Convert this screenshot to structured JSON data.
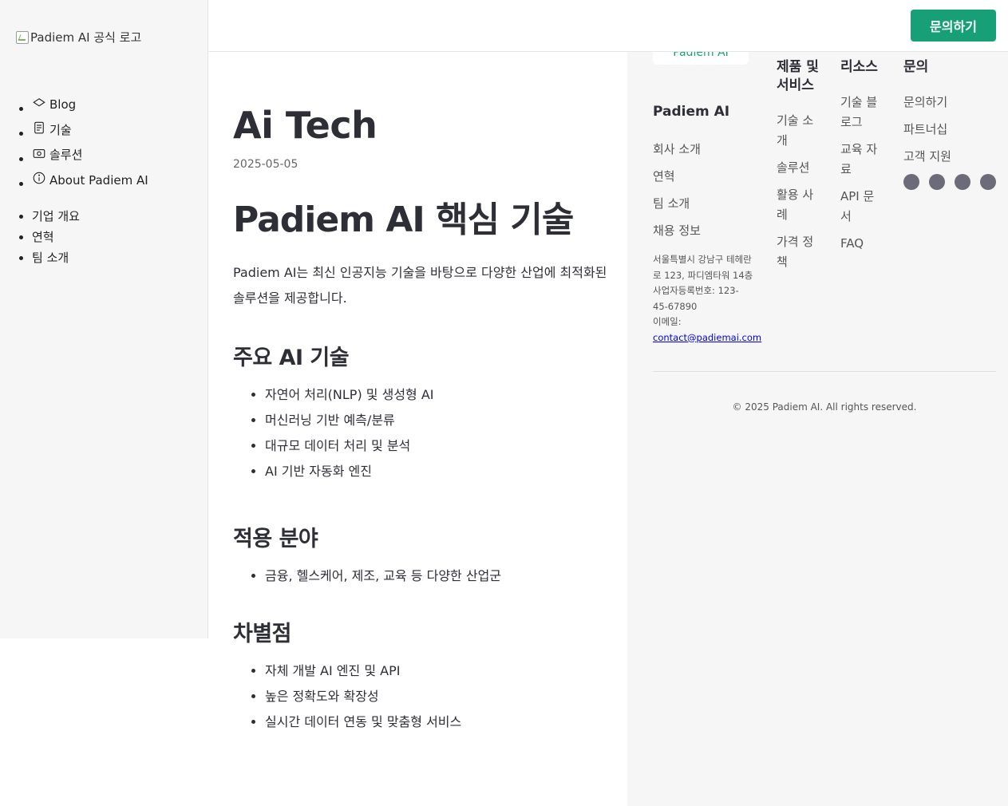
{
  "sidebar": {
    "logo_alt": "Padiem AI 공식 로고",
    "nav": [
      {
        "label": "Blog",
        "icon": "layers-icon"
      },
      {
        "label": "기술",
        "icon": "document-icon"
      },
      {
        "label": "솔루션",
        "icon": "camera-icon"
      },
      {
        "label": "About Padiem AI",
        "icon": "info-icon"
      }
    ],
    "sub": [
      "기업 개요",
      "연혁",
      "팀 소개"
    ]
  },
  "header": {
    "cta_label": "문의하기",
    "accent": "#17a077"
  },
  "article": {
    "title": "Ai Tech",
    "date": "2025-05-05",
    "heading": "Padiem AI 핵심 기술",
    "intro": "Padiem AI는 최신 인공지능 기술을 바탕으로 다양한 산업에 최적화된 솔루션을 제공합니다.",
    "sections": [
      {
        "title": "주요 AI 기술",
        "items": [
          "자연어 처리(NLP) 및 생성형 AI",
          "머신러닝 기반 예측/분류",
          "대규모 데이터 처리 및 분석",
          "AI 기반 자동화 엔진"
        ]
      },
      {
        "title": "적용 분야",
        "items": [
          "금융, 헬스케어, 제조, 교육 등 다양한 산업군"
        ]
      },
      {
        "title": "차별점",
        "items": [
          "자체 개발 AI 엔진 및 API",
          "높은 정확도와 확장성",
          "실시간 데이터 연동 및 맞춤형 서비스"
        ]
      }
    ]
  },
  "footer": {
    "badge": "Padiem AI",
    "brand": "Padiem AI",
    "company_links": [
      "회사 소개",
      "연혁",
      "팀 소개",
      "채용 정보"
    ],
    "address_line1": "서울특별시 강남구 테헤란로 123, 파디엠타워 14층",
    "address_line2": "사업자등록번호: 123-45-67890",
    "email_label": "이메일:",
    "email": "contact@padiemai.com",
    "columns": [
      {
        "title": "제품 및 서비스",
        "items": [
          "기술 소개",
          "솔루션",
          "활용 사례",
          "가격 정책"
        ]
      },
      {
        "title": "리소스",
        "items": [
          "기술 블로그",
          "교육 자료",
          "API 문서",
          "FAQ"
        ]
      },
      {
        "title": "문의",
        "items": [
          "문의하기",
          "파트너십",
          "고객 지원"
        ]
      }
    ],
    "socials": [
      "social-icon-1",
      "social-icon-2",
      "social-icon-3",
      "social-icon-4"
    ],
    "copyright": "© 2025 Padiem AI. All rights reserved."
  }
}
